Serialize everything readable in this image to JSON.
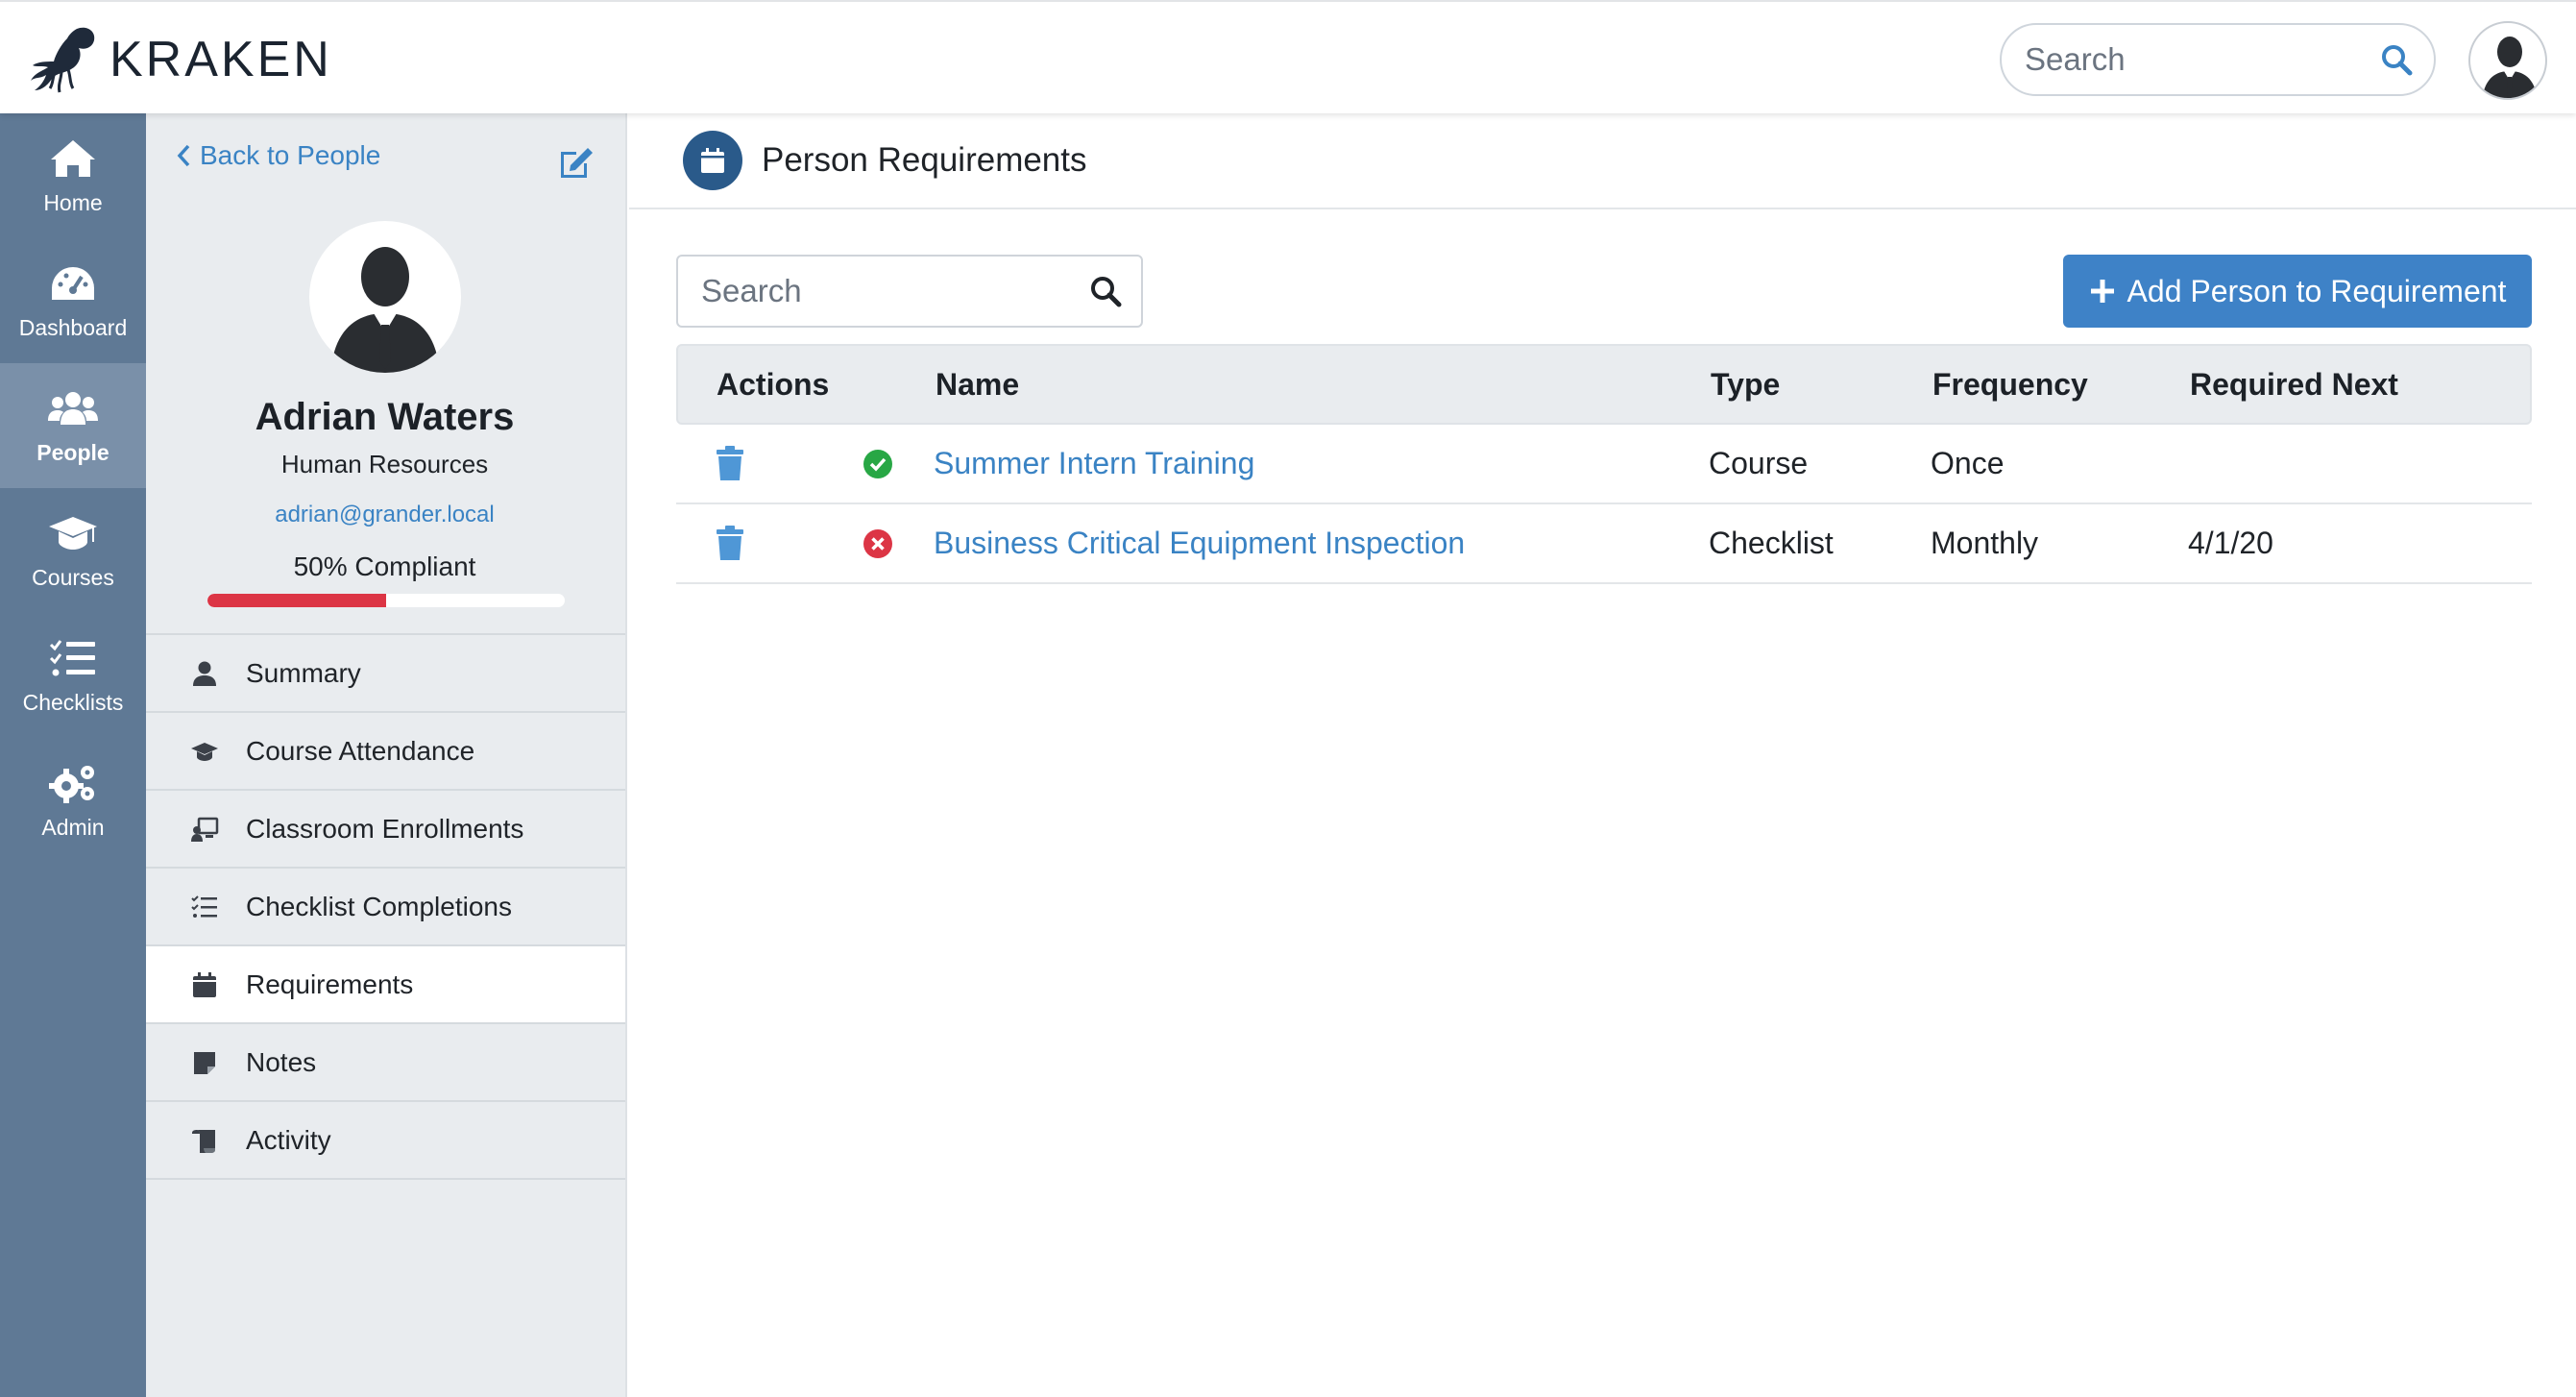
{
  "app": {
    "name": "KRAKEN"
  },
  "topbar": {
    "search_placeholder": "Search"
  },
  "nav": [
    {
      "id": "home",
      "label": "Home",
      "icon": "home-icon",
      "active": false
    },
    {
      "id": "dashboard",
      "label": "Dashboard",
      "icon": "dashboard-icon",
      "active": false
    },
    {
      "id": "people",
      "label": "People",
      "icon": "people-icon",
      "active": true
    },
    {
      "id": "courses",
      "label": "Courses",
      "icon": "graduation-cap-icon",
      "active": false
    },
    {
      "id": "checklists",
      "label": "Checklists",
      "icon": "checklist-icon",
      "active": false
    },
    {
      "id": "admin",
      "label": "Admin",
      "icon": "gears-icon",
      "active": false
    }
  ],
  "profile": {
    "back_label": "Back to People",
    "name": "Adrian Waters",
    "department": "Human Resources",
    "email": "adrian@grander.local",
    "compliance_label": "50% Compliant",
    "compliance_fraction": 0.5,
    "progress_color": "#dc3545",
    "menu": [
      {
        "label": "Summary",
        "icon": "user-icon",
        "active": false
      },
      {
        "label": "Course Attendance",
        "icon": "graduation-cap-icon",
        "active": false
      },
      {
        "label": "Classroom Enrollments",
        "icon": "classroom-icon",
        "active": false
      },
      {
        "label": "Checklist Completions",
        "icon": "checklist-icon",
        "active": false
      },
      {
        "label": "Requirements",
        "icon": "calendar-icon",
        "active": true
      },
      {
        "label": "Notes",
        "icon": "note-icon",
        "active": false
      },
      {
        "label": "Activity",
        "icon": "scroll-icon",
        "active": false
      }
    ]
  },
  "main": {
    "title": "Person Requirements",
    "title_icon": "calendar-icon",
    "search_placeholder": "Search",
    "add_button_label": "Add Person to Requirement",
    "accent_color": "#3e82c7",
    "table": {
      "columns": [
        "Actions",
        "Name",
        "Type",
        "Frequency",
        "Required Next"
      ],
      "rows": [
        {
          "status": "complete",
          "status_icon": "check-circle-icon",
          "status_color": "#28a745",
          "name": "Summer Intern Training",
          "type": "Course",
          "frequency": "Once",
          "required_next": ""
        },
        {
          "status": "incomplete",
          "status_icon": "x-circle-icon",
          "status_color": "#dc3545",
          "name": "Business Critical Equipment Inspection",
          "type": "Checklist",
          "frequency": "Monthly",
          "required_next": "4/1/20"
        }
      ]
    }
  }
}
